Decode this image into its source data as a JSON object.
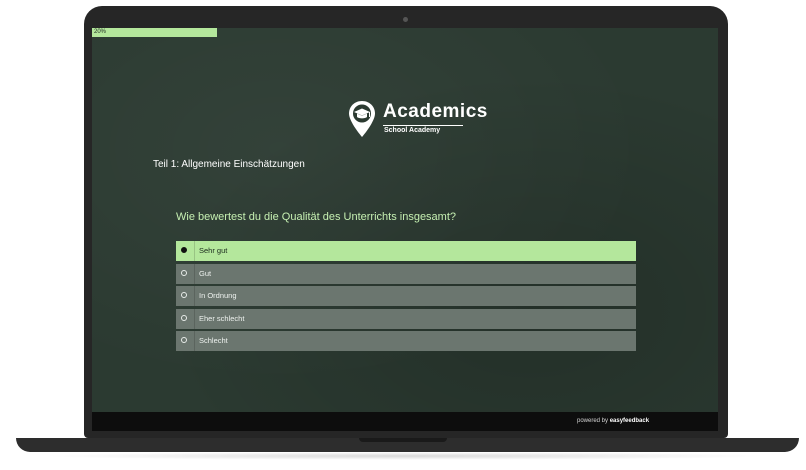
{
  "progress": {
    "label": "20%",
    "value": 0.2,
    "fill_color": "#b4e79c"
  },
  "logo": {
    "title": "Academics",
    "subtitle": "School Academy",
    "icon": "graduation-cap-pin-icon"
  },
  "section": {
    "title": "Teil 1: Allgemeine Einschätzungen"
  },
  "question": {
    "text": "Wie bewertest du die Qualität des Unterrichts insgesamt?",
    "options": [
      {
        "label": "Sehr gut",
        "selected": true
      },
      {
        "label": "Gut",
        "selected": false
      },
      {
        "label": "In Ordnung",
        "selected": false
      },
      {
        "label": "Eher schlecht",
        "selected": false
      },
      {
        "label": "Schlecht",
        "selected": false
      }
    ]
  },
  "footer": {
    "prefix": "powered by",
    "brand": "easyfeedback"
  },
  "colors": {
    "background": "#2b3a31",
    "accent": "#b4e79c",
    "option": "#6b766f"
  }
}
